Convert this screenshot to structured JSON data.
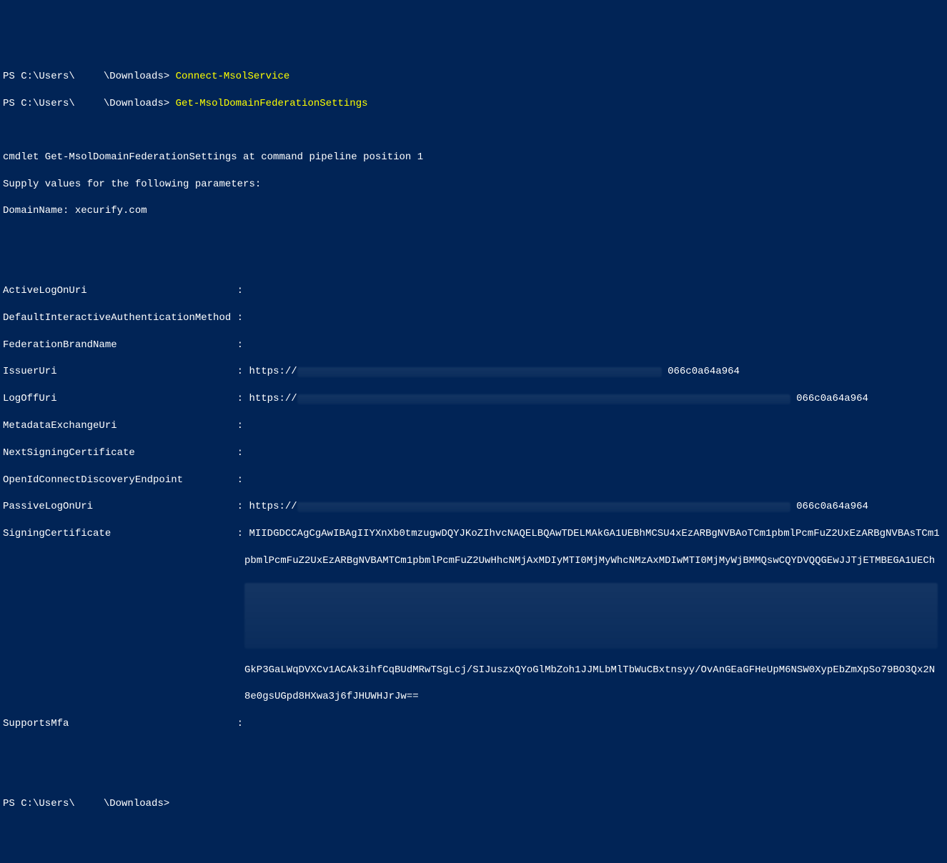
{
  "prompt": {
    "prefix": "PS C:\\Users\\",
    "redacted": true,
    "suffix": "\\Downloads> "
  },
  "commands": {
    "cmd1": "Connect-MsolService",
    "cmd2": "Get-MsolDomainFederationSettings"
  },
  "pipeline": {
    "line1": "cmdlet Get-MsolDomainFederationSettings at command pipeline position 1",
    "line2": "Supply values for the following parameters:",
    "line3": "DomainName: xecurify.com"
  },
  "settings": {
    "keys": {
      "ActiveLogOnUri": "ActiveLogOnUri                         : ",
      "DefaultInteractiveAuthenticationMethod": "DefaultInteractiveAuthenticationMethod : ",
      "FederationBrandName": "FederationBrandName                    : ",
      "IssuerUri": "IssuerUri                              : ",
      "LogOffUri": "LogOffUri                              : ",
      "MetadataExchangeUri": "MetadataExchangeUri                    : ",
      "NextSigningCertificate": "NextSigningCertificate                 : ",
      "OpenIdConnectDiscoveryEndpoint": "OpenIdConnectDiscoveryEndpoint         : ",
      "PassiveLogOnUri": "PassiveLogOnUri                        : ",
      "SigningCertificate": "SigningCertificate                     : ",
      "SupportsMfa": "SupportsMfa                            : "
    },
    "values": {
      "ActiveLogOnUri": "",
      "DefaultInteractiveAuthenticationMethod": "",
      "FederationBrandName": "",
      "IssuerUri_prefix": "https://",
      "IssuerUri_suffix": "066c0a64a964",
      "LogOffUri_prefix": "https://",
      "LogOffUri_suffix": "066c0a64a964",
      "MetadataExchangeUri": "",
      "NextSigningCertificate": "",
      "OpenIdConnectDiscoveryEndpoint": "",
      "PassiveLogOnUri_prefix": "https://",
      "PassiveLogOnUri_suffix": "066c0a64a964",
      "SigningCertificate_line1": "MIIDGDCCAgCgAwIBAgIIYXnXb0tmzugwDQYJKoZIhvcNAQELBQAwTDELMAkGA1UEBhMCSU4xEzARBgNVBAoTCm1pbmlPcmFuZ2UxEzARBgNVBAsTCm1",
      "SigningCertificate_line2": "pbmlPcmFuZ2UxEzARBgNVBAMTCm1pbmlPcmFuZ2UwHhcNMjAxMDIyMTI0MjMyWhcNMzAxMDIwMTI0MjMyWjBMMQswCQYDVQQGEwJJTjETMBEGA1UECh",
      "SigningCertificate_line3": "GkP3GaLWqDVXCv1ACAk3ihfCqBUdMRwTSgLcj/SIJuszxQYoGlMbZoh1JJMLbMlTbWuCBxtnsyy/OvAnGEaGFHeUpM6NSW0XypEbZmXpSo79BO3Qx2N",
      "SigningCertificate_line4": "8e0gsUGpd8HXwa3j6fJHUWHJrJw==",
      "SupportsMfa": ""
    }
  }
}
